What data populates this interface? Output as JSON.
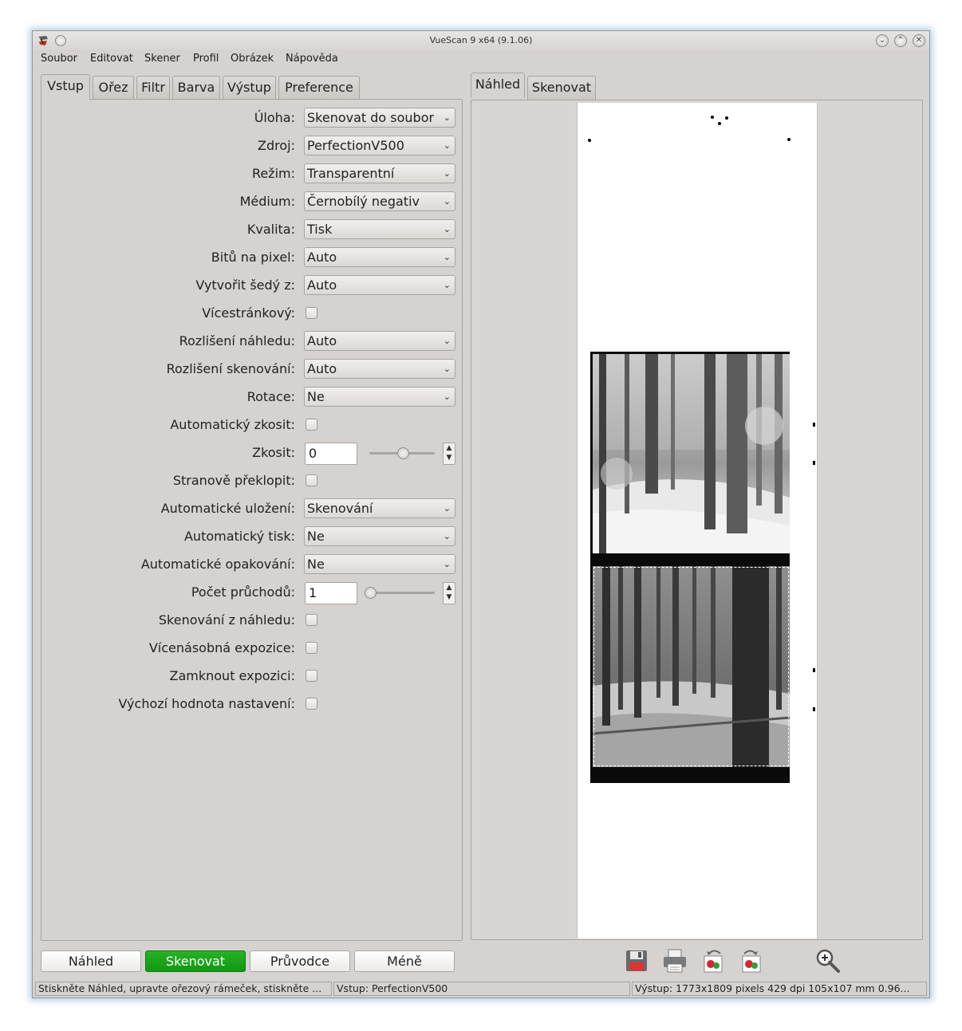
{
  "window": {
    "title": "VueScan 9 x64 (9.1.06)"
  },
  "menu": [
    "Soubor",
    "Editovat",
    "Skener",
    "Profil",
    "Obrázek",
    "Nápověda"
  ],
  "left_tabs": [
    "Vstup",
    "Ořez",
    "Filtr",
    "Barva",
    "Výstup",
    "Preference"
  ],
  "active_left_tab": "Vstup",
  "right_tabs": [
    "Náhled",
    "Skenovat"
  ],
  "active_right_tab": "Náhled",
  "settings": {
    "uloha": {
      "label": "Úloha:",
      "value": "Skenovat do soubor"
    },
    "zdroj": {
      "label": "Zdroj:",
      "value": "PerfectionV500"
    },
    "rezim": {
      "label": "Režim:",
      "value": "Transparentní"
    },
    "medium": {
      "label": "Médium:",
      "value": "Černobílý negativ"
    },
    "kvalita": {
      "label": "Kvalita:",
      "value": "Tisk"
    },
    "bitu": {
      "label": "Bitů na pixel:",
      "value": "Auto"
    },
    "sedy": {
      "label": "Vytvořit šedý z:",
      "value": "Auto"
    },
    "vicestrankovy": {
      "label": "Vícestránkový:",
      "checked": false
    },
    "rozliseni_nahledu": {
      "label": "Rozlišení náhledu:",
      "value": "Auto"
    },
    "rozliseni_skenovani": {
      "label": "Rozlišení skenování:",
      "value": "Auto"
    },
    "rotace": {
      "label": "Rotace:",
      "value": "Ne"
    },
    "auto_zkosit": {
      "label": "Automatický zkosit:",
      "checked": false
    },
    "zkosit": {
      "label": "Zkosit:",
      "value": "0",
      "slider_fraction": 0.5
    },
    "stranove": {
      "label": "Stranově překlopit:",
      "checked": false
    },
    "auto_ulozeni": {
      "label": "Automatické uložení:",
      "value": "Skenování"
    },
    "auto_tisk": {
      "label": "Automatický tisk:",
      "value": "Ne"
    },
    "auto_opakovani": {
      "label": "Automatické opakování:",
      "value": "Ne"
    },
    "pocet": {
      "label": "Počet průchodů:",
      "value": "1",
      "slider_fraction": 0.0
    },
    "sken_z_nahledu": {
      "label": "Skenování z náhledu:",
      "checked": false
    },
    "vicenasobna": {
      "label": "Vícenásobná expozice:",
      "checked": false
    },
    "zamknout": {
      "label": "Zamknout expozici:",
      "checked": false
    },
    "vychozi": {
      "label": "Výchozí hodnota nastavení:",
      "checked": false
    }
  },
  "buttons": {
    "nahled": "Náhled",
    "skenovat": "Skenovat",
    "pruvodce": "Průvodce",
    "mene": "Méně"
  },
  "toolbar_icons": [
    "save-icon",
    "print-icon",
    "rotate-left-icon",
    "rotate-right-icon",
    "zoom-in-icon"
  ],
  "status": {
    "hint": "Stiskněte Náhled, upravte ořezový rámeček, stiskněte ...",
    "input": "Vstup: PerfectionV500",
    "output": "Výstup: 1773x1809 pixels 429 dpi 105x107 mm 0.96..."
  },
  "colors": {
    "primary_button": "#119811",
    "window_bg": "#d6d2d0"
  }
}
